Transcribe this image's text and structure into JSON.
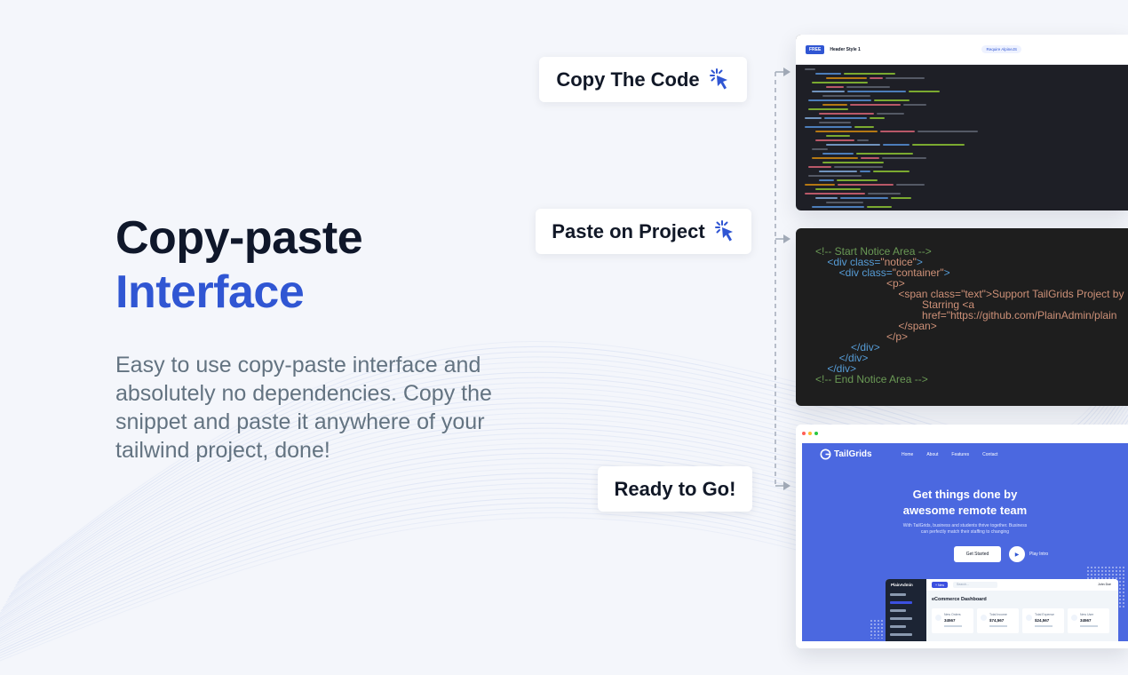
{
  "hero": {
    "title_line1": "Copy-paste",
    "title_line2": "Interface",
    "description": "Easy to use copy-paste interface and absolutely no dependencies. Copy the snippet and paste it anywhere of your tailwind project, done!"
  },
  "steps": {
    "copy_label": "Copy The Code",
    "paste_label": "Paste on Project",
    "ready_label": "Ready to Go!"
  },
  "colors": {
    "accent": "#3056d3",
    "heading": "#0f172a",
    "body_text": "#637381",
    "page_background": "#f4f6fb",
    "code_background": "#1e1e1e",
    "hero_preview": "#4b68e0"
  },
  "icons": {
    "pointer": "cursor-click-icon",
    "arrow": "arrow-right-icon"
  },
  "code_preview": {
    "badge": "FREE",
    "title": "Header Style 1",
    "alpine_badge": "Require AlpineJS"
  },
  "snippet": {
    "lines": [
      {
        "parts": [
          {
            "t": "<!-- Start Notice Area -->",
            "c": "com"
          }
        ]
      },
      {
        "parts": [
          {
            "t": "    <div class=",
            "c": "tag"
          },
          {
            "t": "\"notice\"",
            "c": "str"
          },
          {
            "t": ">",
            "c": "tag"
          }
        ]
      },
      {
        "parts": [
          {
            "t": "        <div class=",
            "c": "tag"
          },
          {
            "t": "\"container\"",
            "c": "str"
          },
          {
            "t": ">",
            "c": "tag"
          }
        ]
      },
      {
        "parts": [
          {
            "t": "                        <p>",
            "c": "txt"
          }
        ]
      },
      {
        "parts": [
          {
            "t": "                            <span class=",
            "c": "txt"
          },
          {
            "t": "\"text\"",
            "c": "str"
          },
          {
            "t": ">Support TailGrids Project by",
            "c": "txt"
          }
        ]
      },
      {
        "parts": [
          {
            "t": "                                    Starring <a",
            "c": "txt"
          }
        ]
      },
      {
        "parts": [
          {
            "t": "                                    href=\"https://github.com/PlainAdmin/plain",
            "c": "txt"
          }
        ]
      },
      {
        "parts": [
          {
            "t": "                            </span>",
            "c": "txt"
          }
        ]
      },
      {
        "parts": [
          {
            "t": "                        </p>",
            "c": "txt"
          }
        ]
      },
      {
        "parts": [
          {
            "t": "            </div>",
            "c": "tag"
          }
        ]
      },
      {
        "parts": [
          {
            "t": "        </div>",
            "c": "tag"
          }
        ]
      },
      {
        "parts": [
          {
            "t": "    </div>",
            "c": "tag"
          }
        ]
      },
      {
        "parts": [
          {
            "t": "<!-- End Notice Area -->",
            "c": "com"
          }
        ]
      }
    ]
  },
  "preview": {
    "logo": "TailGrids",
    "nav_links": [
      "Home",
      "About",
      "Features",
      "Contact"
    ],
    "headline_line1": "Get things done by",
    "headline_line2": "awesome remote team",
    "subtext_line1": "With TailGrids, business and students thrive together. Business",
    "subtext_line2": "can perfectly match their staffing to changing",
    "primary_button": "Get Started",
    "secondary_button": "Play Intro",
    "dashboard": {
      "logo": "PlainAdmin",
      "new_button": "+ New",
      "search_placeholder": "Search...",
      "user_name": "John Doe",
      "title": "eCommerce Dashboard",
      "cards": [
        {
          "label": "New Orders",
          "value": "34567"
        },
        {
          "label": "Total Income",
          "value": "$74,567"
        },
        {
          "label": "Total Expense",
          "value": "$24,567"
        },
        {
          "label": "New User",
          "value": "34567"
        }
      ]
    }
  }
}
